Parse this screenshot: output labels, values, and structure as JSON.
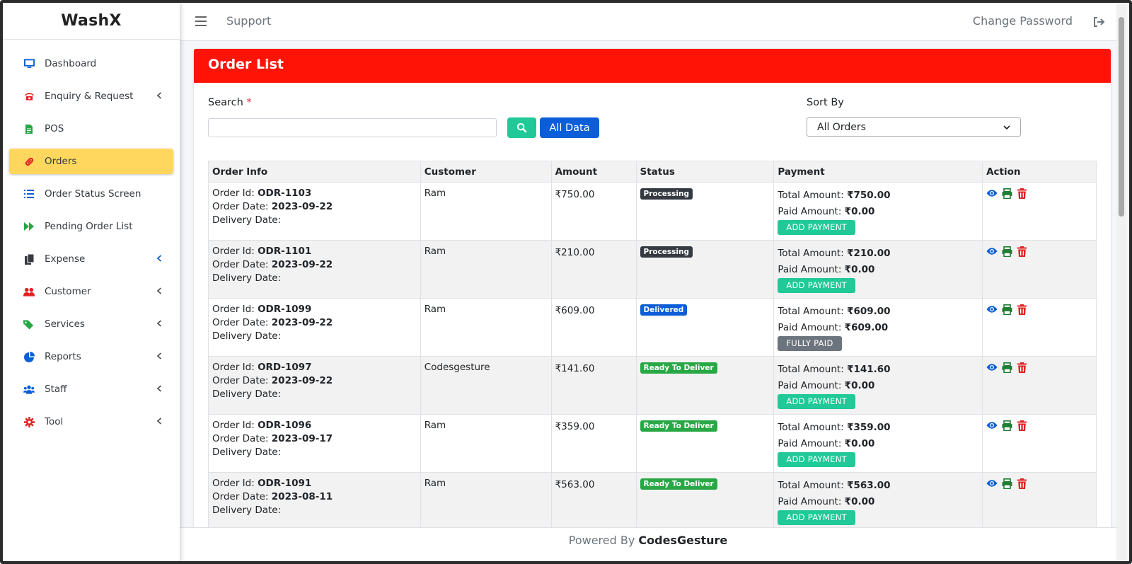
{
  "brand": "WashX",
  "topbar": {
    "support_label": "Support",
    "change_password_label": "Change Password"
  },
  "sidebar": {
    "items": [
      {
        "label": "Dashboard",
        "icon": "monitor-icon",
        "has_arrow": false,
        "active": false
      },
      {
        "label": "Enquiry & Request",
        "icon": "phone-icon",
        "has_arrow": true,
        "active": false
      },
      {
        "label": "POS",
        "icon": "document-icon",
        "has_arrow": false,
        "active": false
      },
      {
        "label": "Orders",
        "icon": "pills-icon",
        "has_arrow": false,
        "active": true
      },
      {
        "label": "Order Status Screen",
        "icon": "list-icon",
        "has_arrow": false,
        "active": false
      },
      {
        "label": "Pending Order List",
        "icon": "fast-forward-icon",
        "has_arrow": false,
        "active": false
      },
      {
        "label": "Expense",
        "icon": "copy-icon",
        "has_arrow": true,
        "active": false
      },
      {
        "label": "Customer",
        "icon": "users-icon",
        "has_arrow": true,
        "active": false
      },
      {
        "label": "Services",
        "icon": "tags-icon",
        "has_arrow": true,
        "active": false
      },
      {
        "label": "Reports",
        "icon": "pie-chart-icon",
        "has_arrow": true,
        "active": false
      },
      {
        "label": "Staff",
        "icon": "staff-icon",
        "has_arrow": true,
        "active": false
      },
      {
        "label": "Tool",
        "icon": "cog-icon",
        "has_arrow": true,
        "active": false
      }
    ]
  },
  "card": {
    "title": "Order List",
    "search_label": "Search",
    "required_mark": "*",
    "search_value": "",
    "all_data_label": "All Data",
    "sort_label": "Sort By",
    "sort_selected": "All Orders"
  },
  "table": {
    "headers": [
      "Order Info",
      "Customer",
      "Amount",
      "Status",
      "Payment",
      "Action"
    ],
    "order_id_label": "Order Id:",
    "order_date_label": "Order Date:",
    "delivery_date_label": "Delivery Date:",
    "total_label": "Total Amount:",
    "paid_label": "Paid Amount:",
    "rows": [
      {
        "order_id": "ODR-1103",
        "order_date": "2023-09-22",
        "customer": "Ram",
        "amount": "₹750.00",
        "status": "Processing",
        "total": "₹750.00",
        "paid": "₹0.00",
        "pay_button": "ADD PAYMENT"
      },
      {
        "order_id": "ODR-1101",
        "order_date": "2023-09-22",
        "customer": "Ram",
        "amount": "₹210.00",
        "status": "Processing",
        "total": "₹210.00",
        "paid": "₹0.00",
        "pay_button": "ADD PAYMENT"
      },
      {
        "order_id": "ODR-1099",
        "order_date": "2023-09-22",
        "customer": "Ram",
        "amount": "₹609.00",
        "status": "Delivered",
        "total": "₹609.00",
        "paid": "₹609.00",
        "pay_button": "FULLY PAID"
      },
      {
        "order_id": "ORD-1097",
        "order_date": "2023-09-22",
        "customer": "Codesgesture",
        "amount": "₹141.60",
        "status": "Ready To Deliver",
        "total": "₹141.60",
        "paid": "₹0.00",
        "pay_button": "ADD PAYMENT"
      },
      {
        "order_id": "ODR-1096",
        "order_date": "2023-09-17",
        "customer": "Ram",
        "amount": "₹359.00",
        "status": "Ready To Deliver",
        "total": "₹359.00",
        "paid": "₹0.00",
        "pay_button": "ADD PAYMENT"
      },
      {
        "order_id": "ODR-1091",
        "order_date": "2023-08-11",
        "customer": "Ram",
        "amount": "₹563.00",
        "status": "Ready To Deliver",
        "total": "₹563.00",
        "paid": "₹0.00",
        "pay_button": "ADD PAYMENT"
      }
    ]
  },
  "status_colors": {
    "Processing": "#343a40",
    "Delivered": "#0b5ed7",
    "Ready To Deliver": "#28a745"
  },
  "pay_button_colors": {
    "ADD PAYMENT": "#20c997",
    "FULLY PAID": "#6c757d"
  },
  "action_icons": [
    "eye-icon",
    "print-icon",
    "trash-icon"
  ],
  "footer": {
    "prefix": "Powered By",
    "brand": "CodesGesture"
  }
}
